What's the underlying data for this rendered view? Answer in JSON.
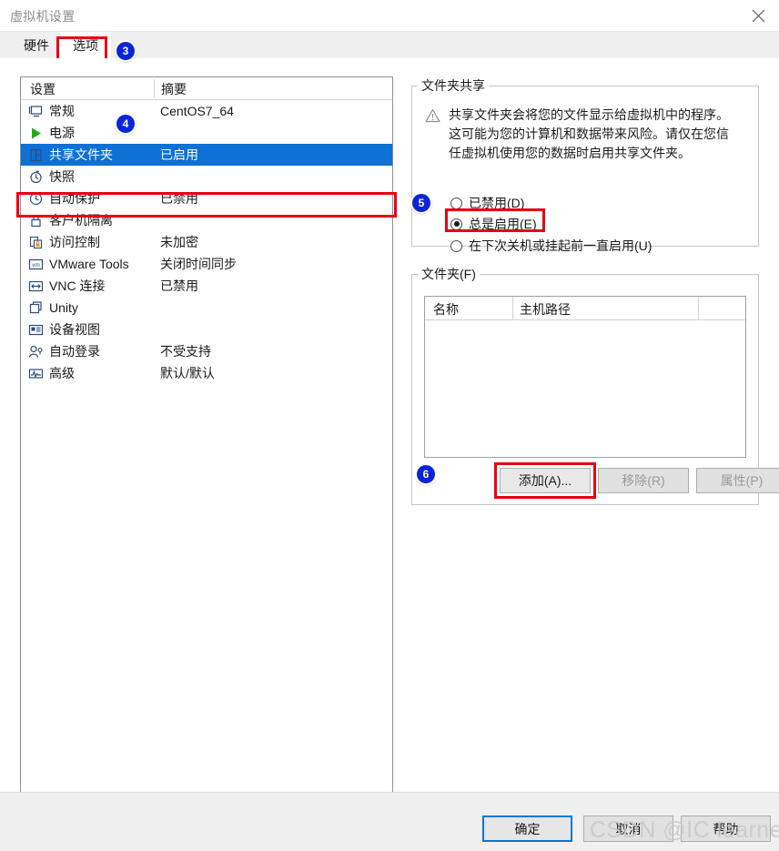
{
  "window": {
    "title": "虚拟机设置",
    "close_icon": "close-icon"
  },
  "tabs": [
    {
      "label": "硬件",
      "selected": false
    },
    {
      "label": "选项",
      "selected": true
    }
  ],
  "step_badges": [
    {
      "number": "3",
      "target": "tab-options"
    },
    {
      "number": "4",
      "target": "settings-row-shared-folders"
    },
    {
      "number": "5",
      "target": "radio-always-enabled"
    },
    {
      "number": "6",
      "target": "add-button"
    }
  ],
  "settings_list": {
    "columns": [
      "设置",
      "摘要"
    ],
    "rows": [
      {
        "icon": "monitor-icon",
        "name": "常规",
        "summary": "CentOS7_64",
        "selected": false
      },
      {
        "icon": "power-play-icon",
        "name": "电源",
        "summary": "",
        "selected": false
      },
      {
        "icon": "shared-folder-icon",
        "name": "共享文件夹",
        "summary": "已启用",
        "selected": true
      },
      {
        "icon": "snapshot-icon",
        "name": "快照",
        "summary": "",
        "selected": false
      },
      {
        "icon": "autoprotect-clock-icon",
        "name": "自动保护",
        "summary": "已禁用",
        "selected": false
      },
      {
        "icon": "lock-icon",
        "name": "客户机隔离",
        "summary": "",
        "selected": false
      },
      {
        "icon": "access-control-icon",
        "name": "访问控制",
        "summary": "未加密",
        "selected": false
      },
      {
        "icon": "vmware-tools-icon",
        "name": "VMware Tools",
        "summary": "关闭时间同步",
        "selected": false
      },
      {
        "icon": "vnc-icon",
        "name": "VNC 连接",
        "summary": "已禁用",
        "selected": false
      },
      {
        "icon": "unity-icon",
        "name": "Unity",
        "summary": "",
        "selected": false
      },
      {
        "icon": "device-view-icon",
        "name": "设备视图",
        "summary": "",
        "selected": false
      },
      {
        "icon": "auto-login-icon",
        "name": "自动登录",
        "summary": "不受支持",
        "selected": false
      },
      {
        "icon": "advanced-icon",
        "name": "高级",
        "summary": "默认/默认",
        "selected": false
      }
    ]
  },
  "folder_sharing": {
    "legend": "文件夹共享",
    "warning_icon": "warning-triangle-icon",
    "warning_text": "共享文件夹会将您的文件显示给虚拟机中的程序。这可能为您的计算机和数据带来风险。请仅在您信任虚拟机使用您的数据时启用共享文件夹。",
    "options": [
      {
        "label": "已禁用(D)",
        "selected": false
      },
      {
        "label": "总是启用(E)",
        "selected": true
      },
      {
        "label": "在下次关机或挂起前一直启用(U)",
        "selected": false
      }
    ]
  },
  "folders": {
    "legend": "文件夹(F)",
    "columns": [
      "名称",
      "主机路径"
    ],
    "rows": [],
    "buttons": [
      {
        "label": "添加(A)...",
        "enabled": true,
        "highlighted": true
      },
      {
        "label": "移除(R)",
        "enabled": false,
        "highlighted": false
      },
      {
        "label": "属性(P)",
        "enabled": false,
        "highlighted": false
      }
    ]
  },
  "dialog_buttons": [
    {
      "label": "确定",
      "default": true
    },
    {
      "label": "取消",
      "default": false
    },
    {
      "label": "帮助",
      "default": false
    }
  ],
  "watermark": "CSDN @IC learner",
  "colors": {
    "selection_blue": "#0d71d6",
    "annotation_red": "#e60012",
    "badge_blue": "#0a24d8",
    "focus_blue": "#0078d7"
  }
}
